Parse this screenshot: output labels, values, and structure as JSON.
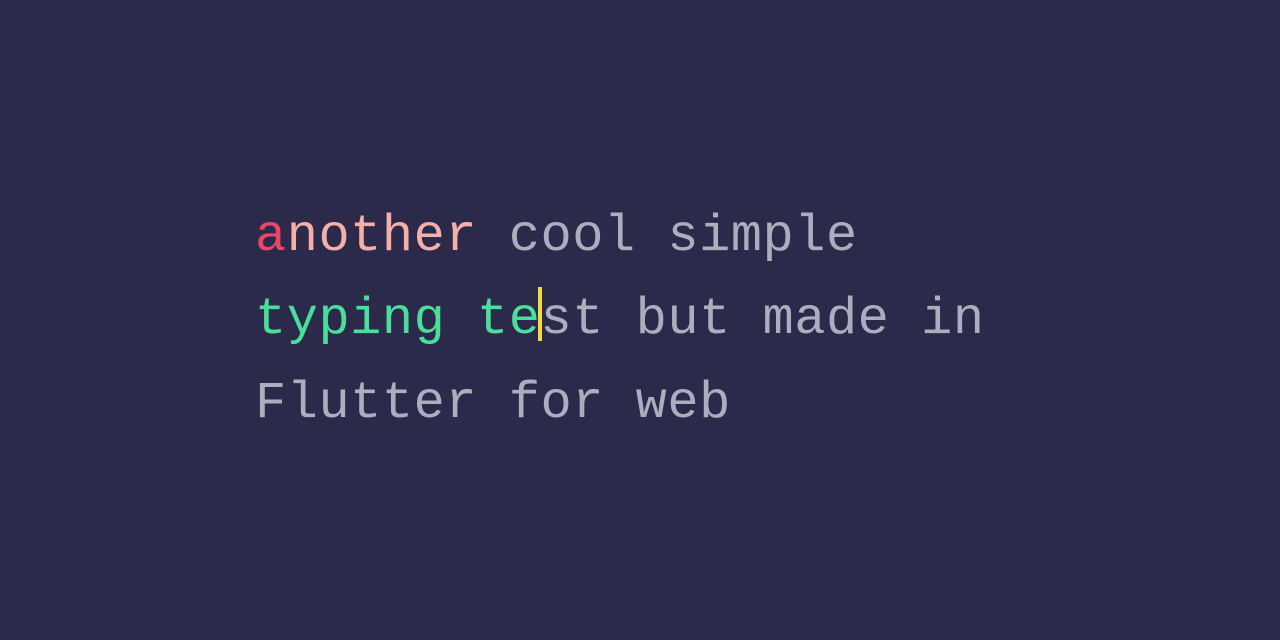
{
  "colors": {
    "background": "#2c2a4a",
    "untyped": "#adadbd",
    "error": "#e94566",
    "neutral": "#f4b0a8",
    "correct": "#4ade9b",
    "caret": "#f7d93d"
  },
  "typing": {
    "full_text": "another cool simple typing test but made in Flutter for web",
    "chars": [
      {
        "c": "a",
        "s": "error"
      },
      {
        "c": "n",
        "s": "neutral"
      },
      {
        "c": "o",
        "s": "neutral"
      },
      {
        "c": "t",
        "s": "neutral"
      },
      {
        "c": "h",
        "s": "neutral"
      },
      {
        "c": "e",
        "s": "neutral"
      },
      {
        "c": "r",
        "s": "neutral"
      },
      {
        "c": " ",
        "s": "untyped"
      },
      {
        "c": "c",
        "s": "untyped"
      },
      {
        "c": "o",
        "s": "untyped"
      },
      {
        "c": "o",
        "s": "untyped"
      },
      {
        "c": "l",
        "s": "untyped"
      },
      {
        "c": " ",
        "s": "untyped"
      },
      {
        "c": "s",
        "s": "untyped"
      },
      {
        "c": "i",
        "s": "untyped"
      },
      {
        "c": "m",
        "s": "untyped"
      },
      {
        "c": "p",
        "s": "untyped"
      },
      {
        "c": "l",
        "s": "untyped"
      },
      {
        "c": "e",
        "s": "untyped"
      },
      {
        "c": " ",
        "s": "untyped"
      },
      {
        "c": "t",
        "s": "correct"
      },
      {
        "c": "y",
        "s": "correct"
      },
      {
        "c": "p",
        "s": "correct"
      },
      {
        "c": "i",
        "s": "correct"
      },
      {
        "c": "n",
        "s": "correct"
      },
      {
        "c": "g",
        "s": "correct"
      },
      {
        "c": " ",
        "s": "correct"
      },
      {
        "c": "t",
        "s": "correct"
      },
      {
        "c": "e",
        "s": "correct"
      },
      {
        "c": "s",
        "s": "untyped"
      },
      {
        "c": "t",
        "s": "untyped"
      },
      {
        "c": " ",
        "s": "untyped"
      },
      {
        "c": "b",
        "s": "untyped"
      },
      {
        "c": "u",
        "s": "untyped"
      },
      {
        "c": "t",
        "s": "untyped"
      },
      {
        "c": " ",
        "s": "untyped"
      },
      {
        "c": "m",
        "s": "untyped"
      },
      {
        "c": "a",
        "s": "untyped"
      },
      {
        "c": "d",
        "s": "untyped"
      },
      {
        "c": "e",
        "s": "untyped"
      },
      {
        "c": " ",
        "s": "untyped"
      },
      {
        "c": "i",
        "s": "untyped"
      },
      {
        "c": "n",
        "s": "untyped"
      },
      {
        "c": " ",
        "s": "untyped"
      },
      {
        "c": "F",
        "s": "untyped"
      },
      {
        "c": "l",
        "s": "untyped"
      },
      {
        "c": "u",
        "s": "untyped"
      },
      {
        "c": "t",
        "s": "untyped"
      },
      {
        "c": "t",
        "s": "untyped"
      },
      {
        "c": "e",
        "s": "untyped"
      },
      {
        "c": "r",
        "s": "untyped"
      },
      {
        "c": " ",
        "s": "untyped"
      },
      {
        "c": "f",
        "s": "untyped"
      },
      {
        "c": "o",
        "s": "untyped"
      },
      {
        "c": "r",
        "s": "untyped"
      },
      {
        "c": " ",
        "s": "untyped"
      },
      {
        "c": "w",
        "s": "untyped"
      },
      {
        "c": "e",
        "s": "untyped"
      },
      {
        "c": "b",
        "s": "untyped"
      }
    ],
    "caret_index": 29
  }
}
